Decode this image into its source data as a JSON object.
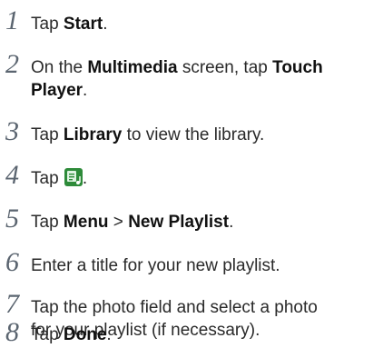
{
  "steps": [
    {
      "number": "1",
      "parts": [
        "Tap ",
        "Start",
        "."
      ]
    },
    {
      "number": "2",
      "parts": [
        "On the ",
        "Multimedia",
        " screen, tap ",
        "Touch",
        "Player",
        "."
      ]
    },
    {
      "number": "3",
      "parts": [
        "Tap ",
        "Library",
        " to view the library."
      ]
    },
    {
      "number": "4",
      "parts": [
        "Tap ",
        "."
      ],
      "icon": "playlist-add-icon",
      "icon_color": "#2e8b3a"
    },
    {
      "number": "5",
      "parts": [
        "Tap ",
        "Menu",
        " > ",
        "New Playlist",
        "."
      ]
    },
    {
      "number": "6",
      "parts": [
        "Enter a title for your new playlist."
      ]
    },
    {
      "number": "7",
      "parts": [
        "Tap the photo field and select a photo",
        "for your playlist (if necessary)."
      ]
    },
    {
      "number": "8",
      "parts": [
        "Tap ",
        "Done",
        "."
      ]
    }
  ]
}
